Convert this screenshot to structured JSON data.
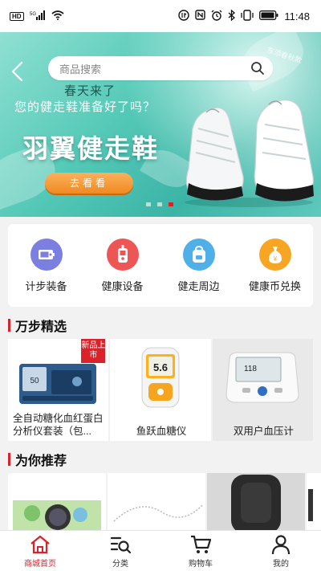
{
  "status_bar": {
    "time": "11:48",
    "left_icons": [
      "hd-icon",
      "signal-5g-icon",
      "wifi-icon"
    ],
    "right_icons": [
      "data-speed-icon",
      "nfc-icon",
      "alarm-icon",
      "bluetooth-icon",
      "vibrate-icon",
      "battery-icon"
    ]
  },
  "search": {
    "placeholder": "商品搜索"
  },
  "banner": {
    "line1": "春天来了",
    "line2": "您的健走鞋准备好了吗？",
    "title": "羽翼健走鞋",
    "cta": "去看看",
    "corner_tag": "东添春秋款",
    "slide_count": 3,
    "active_slide": 3
  },
  "categories": [
    {
      "label": "计步装备",
      "icon": "pedometer-icon",
      "color": "#7b7fe0"
    },
    {
      "label": "健康设备",
      "icon": "glucose-meter-icon",
      "color": "#ee5555"
    },
    {
      "label": "健走周边",
      "icon": "backpack-icon",
      "color": "#4fb0e8"
    },
    {
      "label": "健康币兑换",
      "icon": "coin-bag-icon",
      "color": "#f6a623"
    }
  ],
  "section_picks": {
    "title": "万步精选"
  },
  "products": [
    {
      "name": "全自动糖化血红蛋白分析仪套装（包...",
      "badge": "新品上市",
      "display": "50"
    },
    {
      "name": "鱼跃血糖仪",
      "display": "5.6"
    },
    {
      "name": "双用户血压计",
      "display": "118"
    }
  ],
  "section_recommend": {
    "title": "为你推荐"
  },
  "tabbar": {
    "items": [
      {
        "label": "商城首页",
        "icon": "home-icon",
        "active": true
      },
      {
        "label": "分类",
        "icon": "category-list-icon",
        "active": false
      },
      {
        "label": "购物车",
        "icon": "cart-icon",
        "active": false
      },
      {
        "label": "我的",
        "icon": "user-icon",
        "active": false
      }
    ]
  },
  "colors": {
    "accent": "#d9222a",
    "banner": "#55c9b7",
    "cta": "#f08a22"
  }
}
